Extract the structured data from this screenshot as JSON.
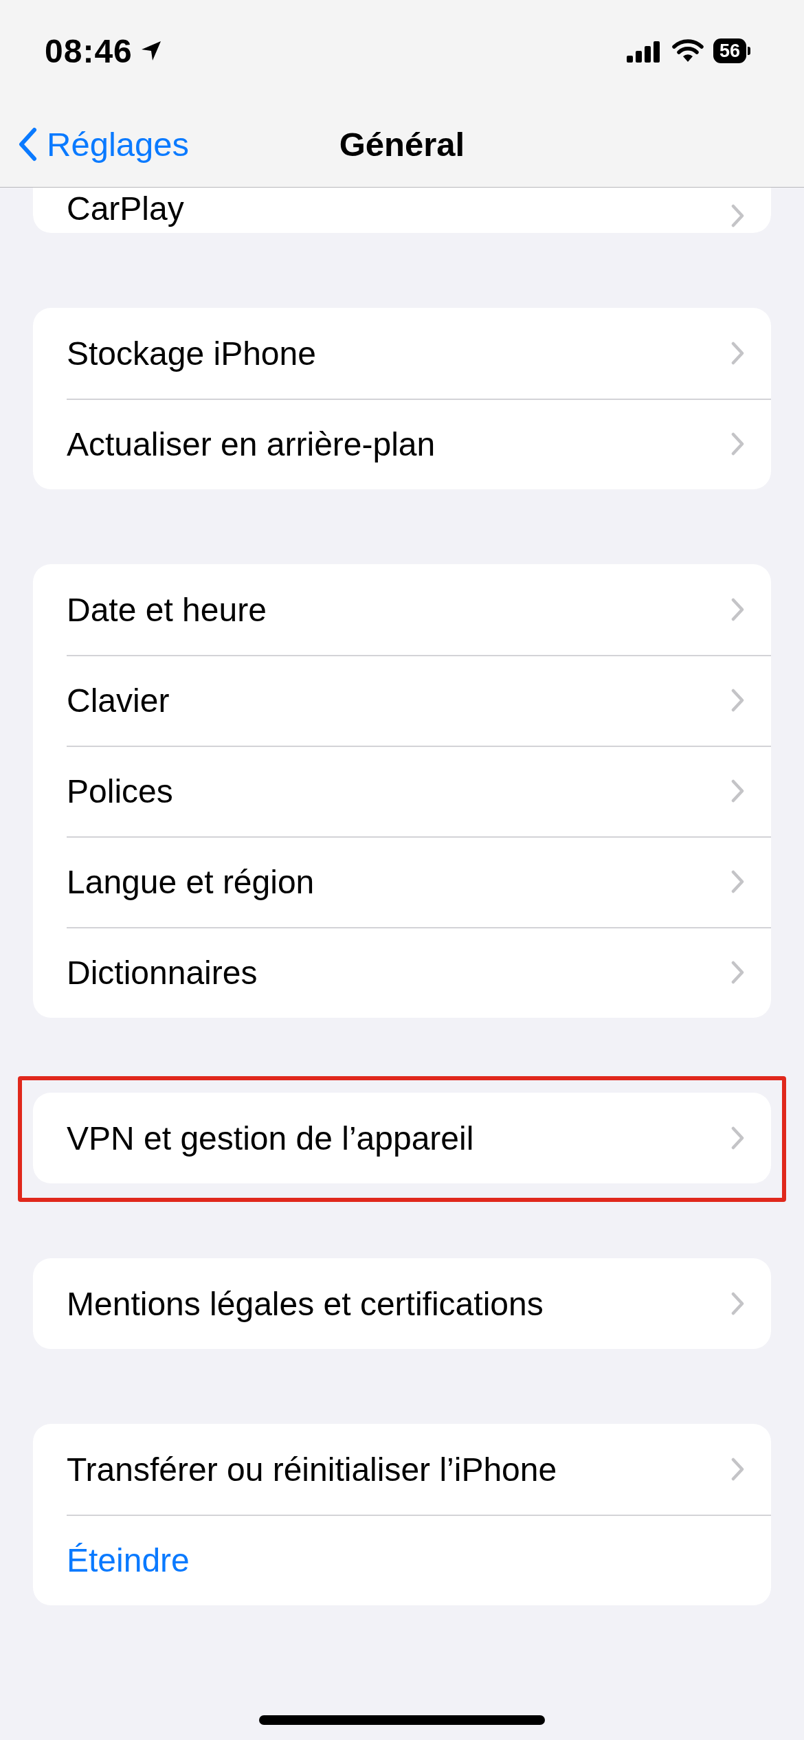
{
  "status_bar": {
    "time": "08:46",
    "battery": "56"
  },
  "nav": {
    "back": "Réglages",
    "title": "Général"
  },
  "groups": [
    {
      "clipped": true,
      "highlighted": false,
      "rows": [
        {
          "label": "CarPlay",
          "kind": "link"
        }
      ]
    },
    {
      "clipped": false,
      "highlighted": false,
      "rows": [
        {
          "label": "Stockage iPhone",
          "kind": "link"
        },
        {
          "label": "Actualiser en arrière-plan",
          "kind": "link"
        }
      ]
    },
    {
      "clipped": false,
      "highlighted": false,
      "rows": [
        {
          "label": "Date et heure",
          "kind": "link"
        },
        {
          "label": "Clavier",
          "kind": "link"
        },
        {
          "label": "Polices",
          "kind": "link"
        },
        {
          "label": "Langue et région",
          "kind": "link"
        },
        {
          "label": "Dictionnaires",
          "kind": "link"
        }
      ]
    },
    {
      "clipped": false,
      "highlighted": true,
      "rows": [
        {
          "label": "VPN et gestion de l’appareil",
          "kind": "link"
        }
      ]
    },
    {
      "clipped": false,
      "highlighted": false,
      "rows": [
        {
          "label": "Mentions légales et certifications",
          "kind": "link"
        }
      ]
    },
    {
      "clipped": false,
      "highlighted": false,
      "rows": [
        {
          "label": "Transférer ou réinitialiser l’iPhone",
          "kind": "link"
        },
        {
          "label": "Éteindre",
          "kind": "action"
        }
      ]
    }
  ]
}
